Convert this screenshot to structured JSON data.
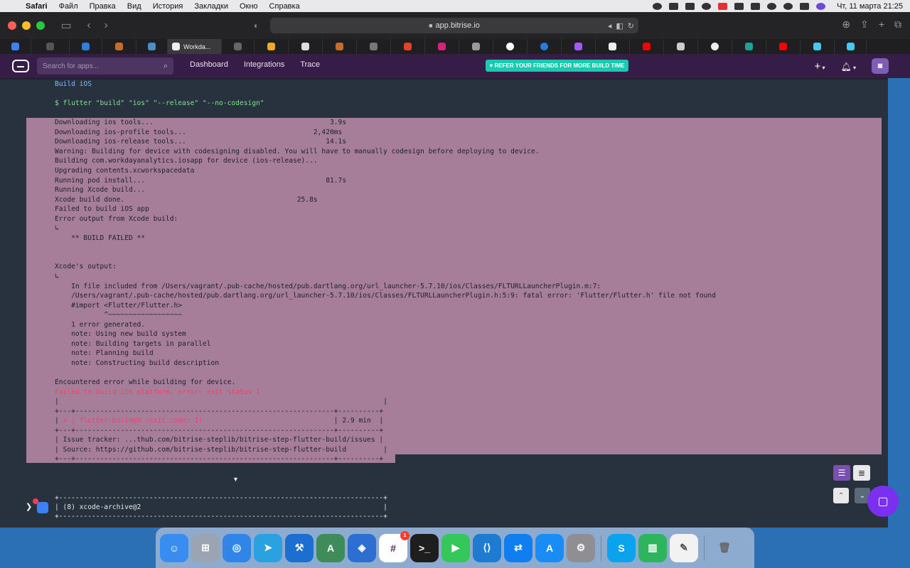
{
  "menubar": {
    "items": [
      "Safari",
      "Файл",
      "Правка",
      "Вид",
      "История",
      "Закладки",
      "Окно",
      "Справка"
    ],
    "clock": "Чт, 11 марта  21:25"
  },
  "browser": {
    "url": "app.bitrise.io",
    "active_tab_title": "Workda..."
  },
  "bitrise": {
    "search_placeholder": "Search for apps...",
    "nav": [
      "Dashboard",
      "Integrations",
      "Trace"
    ],
    "promo": "♥ REFER YOUR FRIENDS FOR MORE BUILD TIME",
    "plus": "+",
    "bell": "🔔"
  },
  "log": {
    "lines": [
      {
        "text": "Build iOS",
        "color": "blue"
      },
      {
        "text": "",
        "color": "plain"
      },
      {
        "text": "$ flutter \"build\" \"ios\" \"--release\" \"--no-codesign\"",
        "color": "green"
      },
      {
        "text": "",
        "color": "plain"
      },
      {
        "text": "Downloading ios tools...                                           3.9s",
        "color": "plain"
      },
      {
        "text": "Downloading ios-profile tools...                               2,420ms",
        "color": "plain"
      },
      {
        "text": "Downloading ios-release tools...                                  14.1s",
        "color": "plain"
      },
      {
        "text": "Warning: Building for device with codesigning disabled. You will have to manually codesign before deploying to device.",
        "color": "plain"
      },
      {
        "text": "Building com.workdayanalytics.iosapp for device (ios-release)...",
        "color": "plain"
      },
      {
        "text": "Upgrading contents.xcworkspacedata",
        "color": "plain"
      },
      {
        "text": "Running pod install...                                            81.7s",
        "color": "plain"
      },
      {
        "text": "Running Xcode build...",
        "color": "plain"
      },
      {
        "text": "Xcode build done.                                          25.8s",
        "color": "plain"
      },
      {
        "text": "Failed to build iOS app",
        "color": "plain"
      },
      {
        "text": "Error output from Xcode build:",
        "color": "plain"
      },
      {
        "text": "↳",
        "color": "plain"
      },
      {
        "text": "    ** BUILD FAILED **",
        "color": "plain"
      },
      {
        "text": "",
        "color": "plain"
      },
      {
        "text": "",
        "color": "plain"
      },
      {
        "text": "Xcode's output:",
        "color": "plain"
      },
      {
        "text": "↳",
        "color": "plain"
      },
      {
        "text": "    In file included from /Users/vagrant/.pub-cache/hosted/pub.dartlang.org/url_launcher-5.7.10/ios/Classes/FLTURLLauncherPlugin.m:7:",
        "color": "plain"
      },
      {
        "text": "    /Users/vagrant/.pub-cache/hosted/pub.dartlang.org/url_launcher-5.7.10/ios/Classes/FLTURLLauncherPlugin.h:5:9: fatal error: 'Flutter/Flutter.h' file not found",
        "color": "plain"
      },
      {
        "text": "    #import <Flutter/Flutter.h>",
        "color": "plain"
      },
      {
        "text": "            ^~~~~~~~~~~~~~~~~~~",
        "color": "plain"
      },
      {
        "text": "    1 error generated.",
        "color": "plain"
      },
      {
        "text": "    note: Using new build system",
        "color": "plain"
      },
      {
        "text": "    note: Building targets in parallel",
        "color": "plain"
      },
      {
        "text": "    note: Planning build",
        "color": "plain"
      },
      {
        "text": "    note: Constructing build description",
        "color": "plain"
      },
      {
        "text": "",
        "color": "plain"
      },
      {
        "text": "Encountered error while building for device.",
        "color": "plain"
      },
      {
        "text": "Failed to build iOS platform, error: exit status 1",
        "color": "red"
      },
      {
        "text": "|                                                                               |",
        "color": "plain"
      },
      {
        "text": "+---+---------------------------------------------------------------+----------+",
        "color": "plain"
      },
      {
        "text": "| x | flutter-build@0 (exit code: 1)                                | 2.9 min  |",
        "color": "mixed"
      },
      {
        "text": "+---+---------------------------------------------------------------+----------+",
        "color": "plain"
      },
      {
        "text": "| Issue tracker: ...thub.com/bitrise-steplib/bitrise-step-flutter-build/issues |",
        "color": "plain"
      },
      {
        "text": "| Source: https://github.com/bitrise-steplib/bitrise-step-flutter-build         |",
        "color": "plain"
      },
      {
        "text": "+---+---------------------------------------------------------------+----------+",
        "color": "plain"
      }
    ],
    "next_step": {
      "top_rule": "+-------------------------------------------------------------------------------+",
      "label": "| (8) xcode-archive@2                                                           |",
      "bottom_rule": "+-------------------------------------------------------------------------------+"
    },
    "scroll_marker": "▼"
  },
  "dock": {
    "apps": [
      "Finder",
      "Launchpad",
      "Safari",
      "Telegram",
      "Xcode",
      "Android Studio",
      "Instruments",
      "Slack",
      "Terminal",
      "FaceTime",
      "VS Code",
      "TeamViewer",
      "App Store",
      "System Preferences",
      "Skype",
      "Numbers",
      "TextEdit",
      "Trash"
    ],
    "slack_badge": "1"
  }
}
